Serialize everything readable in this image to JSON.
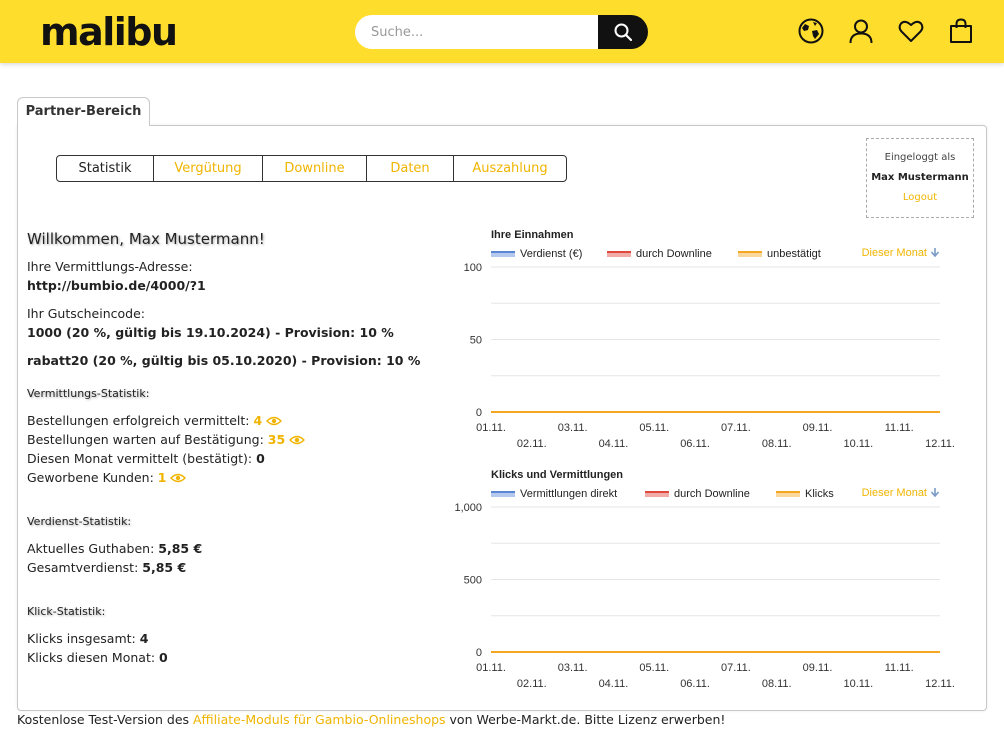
{
  "header": {
    "logo": "malibu",
    "search": {
      "placeholder": "Suche..."
    },
    "icons": [
      "globe-icon",
      "user-icon",
      "heart-icon",
      "shopping-bag-icon"
    ]
  },
  "main_tab": {
    "label": "Partner-Bereich"
  },
  "subtabs": [
    {
      "label": "Statistik",
      "width": 96
    },
    {
      "label": "Vergütung",
      "width": 109
    },
    {
      "label": "Downline",
      "width": 104
    },
    {
      "label": "Daten",
      "width": 87
    },
    {
      "label": "Auszahlung",
      "width": 113
    }
  ],
  "login": {
    "prefix": "Eingeloggt als",
    "name": "Max Mustermann",
    "logout": "Logout"
  },
  "welcome": "Willkommen, Max Mustermann!",
  "address": {
    "label": "Ihre Vermittlungs-Adresse:",
    "value": "http://bumbio.de/4000/?1"
  },
  "coupon": {
    "label": "Ihr Gutscheincode:",
    "items": [
      "1000 (20 %, gültig bis 19.10.2024) - Provision: 10 %",
      "rabatt20 (20 %, gültig bis 05.10.2020) - Provision: 10 %"
    ]
  },
  "vermittlung": {
    "heading": "Vermittlungs-Statistik:",
    "rows": [
      {
        "label": "Bestellungen erfolgreich vermittelt: ",
        "value": "4"
      },
      {
        "label": "Bestellungen warten auf Bestätigung: ",
        "value": "35"
      },
      {
        "label": "Diesen Monat vermittelt (bestätigt): ",
        "value": "0"
      },
      {
        "label": "Geworbene Kunden: ",
        "value": "1"
      }
    ]
  },
  "verdienst": {
    "heading": "Verdienst-Statistik:",
    "rows": [
      {
        "label": "Aktuelles Guthaben: ",
        "value": "5,85 €"
      },
      {
        "label": "Gesamtverdienst: ",
        "value": "5,85 €"
      }
    ]
  },
  "klick": {
    "heading": "Klick-Statistik:",
    "rows": [
      {
        "label": "Klicks insgesamt: ",
        "value": "4"
      },
      {
        "label": "Klicks diesen Monat: ",
        "value": "0"
      }
    ]
  },
  "chart_data": [
    {
      "type": "line",
      "title": "Ihre Einnahmen",
      "period_label": "Dieser Monat",
      "x": [
        "01.11.",
        "02.11.",
        "03.11.",
        "04.11.",
        "05.11.",
        "06.11.",
        "07.11.",
        "08.11.",
        "09.11.",
        "10.11.",
        "11.11.",
        "12.11."
      ],
      "ylim": [
        0,
        100
      ],
      "yticks": [
        "0",
        "50",
        "100"
      ],
      "series": [
        {
          "name": "Verdienst (€)",
          "color": "#5b86d6",
          "values": [
            0,
            0,
            0,
            0,
            0,
            0,
            0,
            0,
            0,
            0,
            0,
            0
          ]
        },
        {
          "name": "durch Downline",
          "color": "#e0483c",
          "values": [
            0,
            0,
            0,
            0,
            0,
            0,
            0,
            0,
            0,
            0,
            0,
            0
          ]
        },
        {
          "name": "unbestätigt",
          "color": "#f5a623",
          "values": [
            0,
            0,
            0,
            0,
            0,
            0,
            0,
            0,
            0,
            0,
            0,
            0
          ]
        }
      ]
    },
    {
      "type": "line",
      "title": "Klicks und Vermittlungen",
      "period_label": "Dieser Monat",
      "x": [
        "01.11.",
        "02.11.",
        "03.11.",
        "04.11.",
        "05.11.",
        "06.11.",
        "07.11.",
        "08.11.",
        "09.11.",
        "10.11.",
        "11.11.",
        "12.11."
      ],
      "ylim": [
        0,
        1000
      ],
      "yticks": [
        "0",
        "500",
        "1,000"
      ],
      "series": [
        {
          "name": "Vermittlungen direkt",
          "color": "#5b86d6",
          "values": [
            0,
            0,
            0,
            0,
            0,
            0,
            0,
            0,
            0,
            0,
            0,
            0
          ]
        },
        {
          "name": "durch Downline",
          "color": "#e0483c",
          "values": [
            0,
            0,
            0,
            0,
            0,
            0,
            0,
            0,
            0,
            0,
            0,
            0
          ]
        },
        {
          "name": "Klicks",
          "color": "#f5a623",
          "values": [
            0,
            0,
            0,
            0,
            0,
            0,
            0,
            0,
            0,
            0,
            0,
            0
          ]
        }
      ]
    }
  ],
  "footer": {
    "prefix": "Kostenlose Test-Version des ",
    "link": "Affiliate-Moduls für Gambio-Onlineshops",
    "suffix": " von Werbe-Markt.de. Bitte Lizenz erwerben!"
  }
}
